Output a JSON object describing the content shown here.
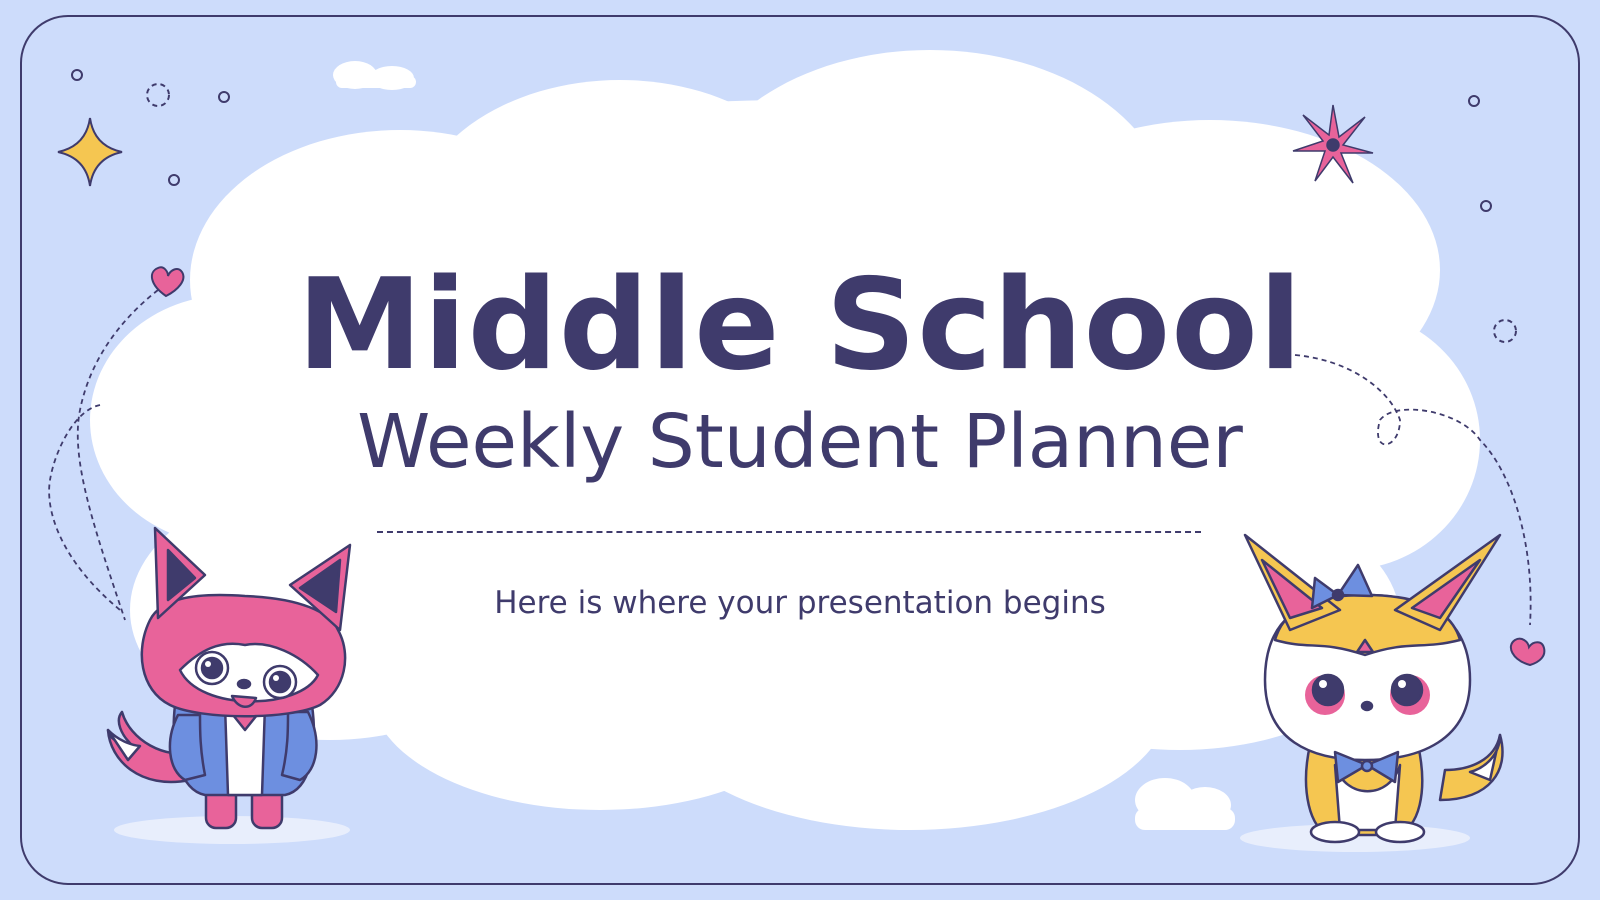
{
  "slide": {
    "title": "Middle School",
    "subtitle": "Weekly Student Planner",
    "tagline": "Here is where your presentation begins"
  },
  "colors": {
    "background": "#cddcfb",
    "cloud": "#ffffff",
    "text": "#3f3b6c",
    "pink": "#e8639a",
    "yellow": "#f5c651",
    "blue": "#6d8fe0"
  },
  "decorations": {
    "left_character": "pink-fox-character",
    "right_character": "yellow-fox-character",
    "icons": [
      "sparkle-icon",
      "flower-icon",
      "heart-icon",
      "small-cloud-icon",
      "circle-dot-icon"
    ]
  }
}
